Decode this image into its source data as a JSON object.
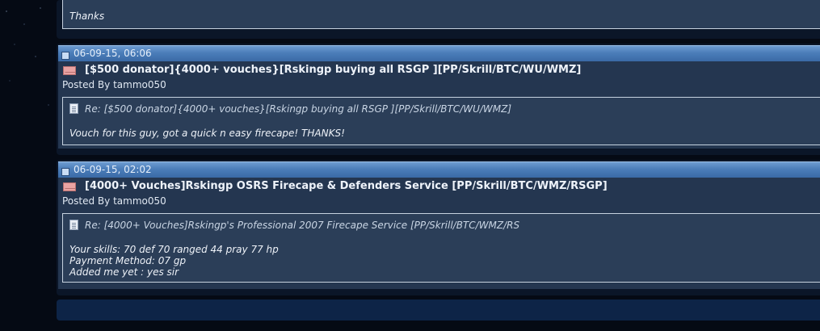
{
  "top_post": {
    "thanks_text": "Thanks"
  },
  "posts": [
    {
      "date": "06-09-15, 06:06",
      "title": "[$500 donator]{4000+ vouches}[Rskingp buying all RSGP ][PP/Skrill/BTC/WU/WMZ]",
      "posted_by_label": "Posted By",
      "author": "tammo050",
      "quote_re": "Re: [$500 donator]{4000+ vouches}[Rskingp buying all RSGP ][PP/Skrill/BTC/WU/WMZ]",
      "quote_lines": [
        "Vouch for this guy, got a quick n easy firecape! THANKS!"
      ]
    },
    {
      "date": "06-09-15, 02:02",
      "title": "[4000+ Vouches]Rskingp OSRS Firecape & Defenders Service [PP/Skrill/BTC/WMZ/RSGP]",
      "posted_by_label": "Posted By",
      "author": "tammo050",
      "quote_re": "Re: [4000+ Vouches]Rskingp's Professional 2007 Firecape Service [PP/Skrill/BTC/WMZ/RS",
      "quote_lines": [
        "Your skills: 70 def 70 ranged 44 pray 77 hp",
        "Payment Method: 07 gp",
        "Added me yet : yes sir"
      ]
    }
  ],
  "icons": {
    "date": "post-date-icon",
    "title": "envelope-icon",
    "quote": "document-icon"
  },
  "colors": {
    "page_bg": "#050a14",
    "panel_bg": "#0b1628",
    "header_blue": "#4b7db9",
    "post_bg": "#243650",
    "quote_bg": "#2b3e58"
  }
}
